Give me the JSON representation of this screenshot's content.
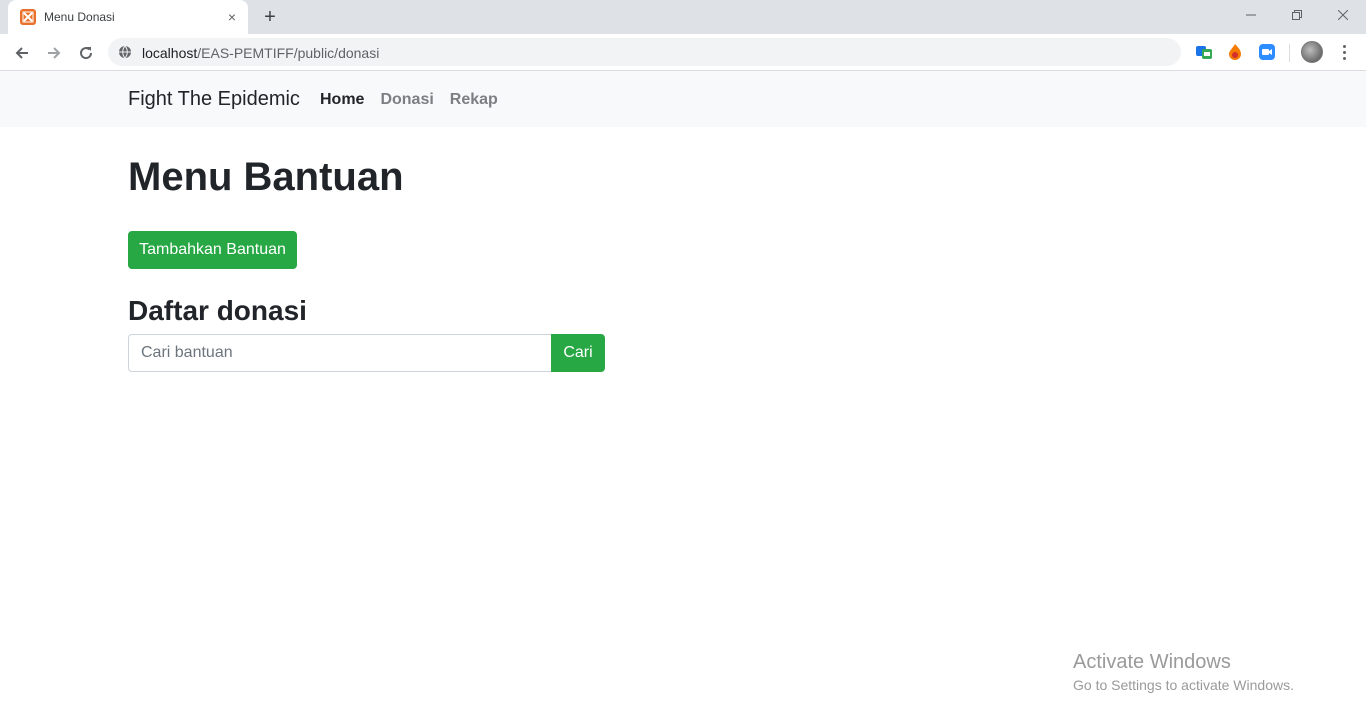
{
  "browser": {
    "tab_title": "Menu Donasi",
    "tab_close": "×",
    "new_tab": "+",
    "url_host": "localhost",
    "url_path": "/EAS-PEMTIFF/public/donasi",
    "icons": {
      "favicon": "xampp-icon",
      "back": "arrow-left-icon",
      "forward": "arrow-right-icon",
      "reload": "reload-icon",
      "site_info": "globe-icon",
      "ext1": "translate-extension-icon",
      "ext2": "flame-extension-icon",
      "ext3": "zoom-extension-icon",
      "menu": "kebab-menu-icon"
    }
  },
  "navbar": {
    "brand": "Fight The Epidemic",
    "links": [
      {
        "label": "Home",
        "active": true
      },
      {
        "label": "Donasi",
        "active": false
      },
      {
        "label": "Rekap",
        "active": false
      }
    ]
  },
  "main": {
    "title": "Menu Bantuan",
    "add_button": "Tambahkan Bantuan",
    "section_title": "Daftar donasi",
    "search": {
      "placeholder": "Cari bantuan",
      "value": "",
      "button": "Cari"
    }
  },
  "watermark": {
    "title": "Activate Windows",
    "subtitle": "Go to Settings to activate Windows."
  },
  "colors": {
    "success": "#28a745",
    "navbar_bg": "#f8f9fa",
    "text": "#212529",
    "muted_link": "#7b7f83"
  }
}
